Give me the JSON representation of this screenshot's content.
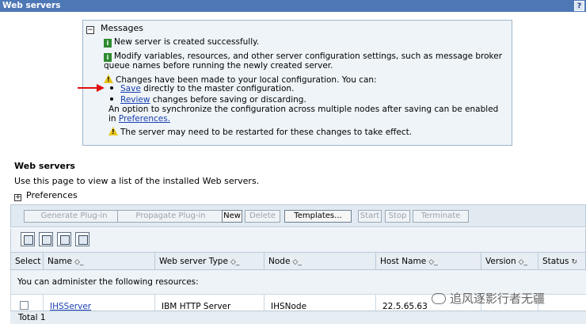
{
  "title": "Web servers",
  "help": "?",
  "messages": {
    "header": "Messages",
    "info1": "New server is created successfully.",
    "info2a": "Modify variables, resources, and other server configuration settings, such as message broker",
    "info2b": "queue names before running the newly created server.",
    "warn1": "Changes have been made to your local configuration. You can:",
    "save_link": "Save",
    "save_rest": " directly to the master configuration.",
    "review_link": "Review",
    "review_rest": " changes before saving or discarding.",
    "sync_a": "An option to synchronize the configuration across multiple nodes after saving can be enabled",
    "sync_in": "in ",
    "prefs_link": "Preferences.",
    "warn2": "The server may need to be restarted for these changes to take effect."
  },
  "section": {
    "title": "Web servers",
    "description": "Use this page to view a list of the installed Web servers.",
    "preferences": "Preferences"
  },
  "toolbar": {
    "generate": "Generate Plug-in",
    "propagate": "Propagate Plug-in",
    "new": "New",
    "delete": "Delete",
    "templates": "Templates...",
    "start": "Start",
    "stop": "Stop",
    "terminate": "Terminate"
  },
  "table": {
    "headers": {
      "select": "Select",
      "name": "Name",
      "type": "Web server Type",
      "node": "Node",
      "host": "Host Name",
      "version": "Version",
      "status": "Status"
    },
    "resource_note": "You can administer the following resources:",
    "rows": [
      {
        "name": "IHSServer",
        "type": "IBM HTTP Server",
        "node": "IHSNode",
        "host": "22.5.65.63"
      }
    ],
    "total": "Total 1"
  },
  "watermark": "追风逐影行者无疆",
  "colors": {
    "titlebar": "#4d78b5",
    "link": "#1a3fb0",
    "arrow": "#e01010"
  }
}
